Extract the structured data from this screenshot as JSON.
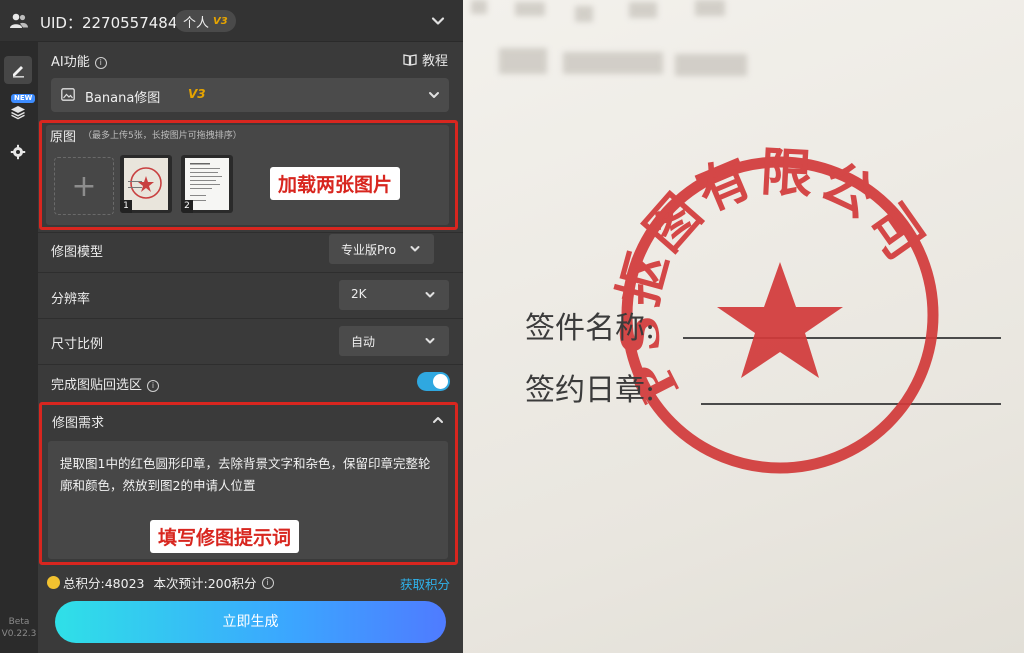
{
  "topbar": {
    "uid_text": "UID：2270557484",
    "badge_label": "个人",
    "badge_version": "V3"
  },
  "rail": {
    "new_badge": "NEW",
    "version_line1": "Beta",
    "version_line2": "V0.22.3"
  },
  "ai_function": {
    "label": "AI功能",
    "info_symbol": "i",
    "tutorial_label": "教程"
  },
  "model_selector": {
    "name": "Banana修图",
    "version": "V3"
  },
  "original_image": {
    "label": "原图",
    "hint": "（最多上传5张，长按图片可拖拽排序）",
    "upload_symbol": "+",
    "thumbnails": [
      {
        "number": "1"
      },
      {
        "number": "2"
      }
    ],
    "callout": "加载两张图片"
  },
  "settings": {
    "model_label": "修图模型",
    "model_value": "专业版Pro",
    "resolution_label": "分辨率",
    "resolution_value": "2K",
    "ratio_label": "尺寸比例",
    "ratio_value": "自动",
    "paste_back_label": "完成图贴回选区",
    "paste_back_enabled": true
  },
  "requirement": {
    "label": "修图需求",
    "text": "提取图1中的红色圆形印章，去除背景文字和杂色，保留印章完整轮廓和颜色，然放到图2的申请人位置",
    "callout": "填写修图提示词"
  },
  "footer": {
    "total_points": "总积分:48023",
    "estimate": "本次预计:200积分",
    "get_points": "获取积分",
    "generate_button": "立即生成"
  },
  "document": {
    "sign_name_label": "签件名称:",
    "sign_date_label": "签约日章:",
    "stamp_text": "PS抠图有限公司",
    "stamp_color": "#d23a3a"
  },
  "colors": {
    "accent_red": "#d8261f",
    "accent_blue": "#2fa8e0",
    "panel_bg": "#3a3a3a"
  }
}
